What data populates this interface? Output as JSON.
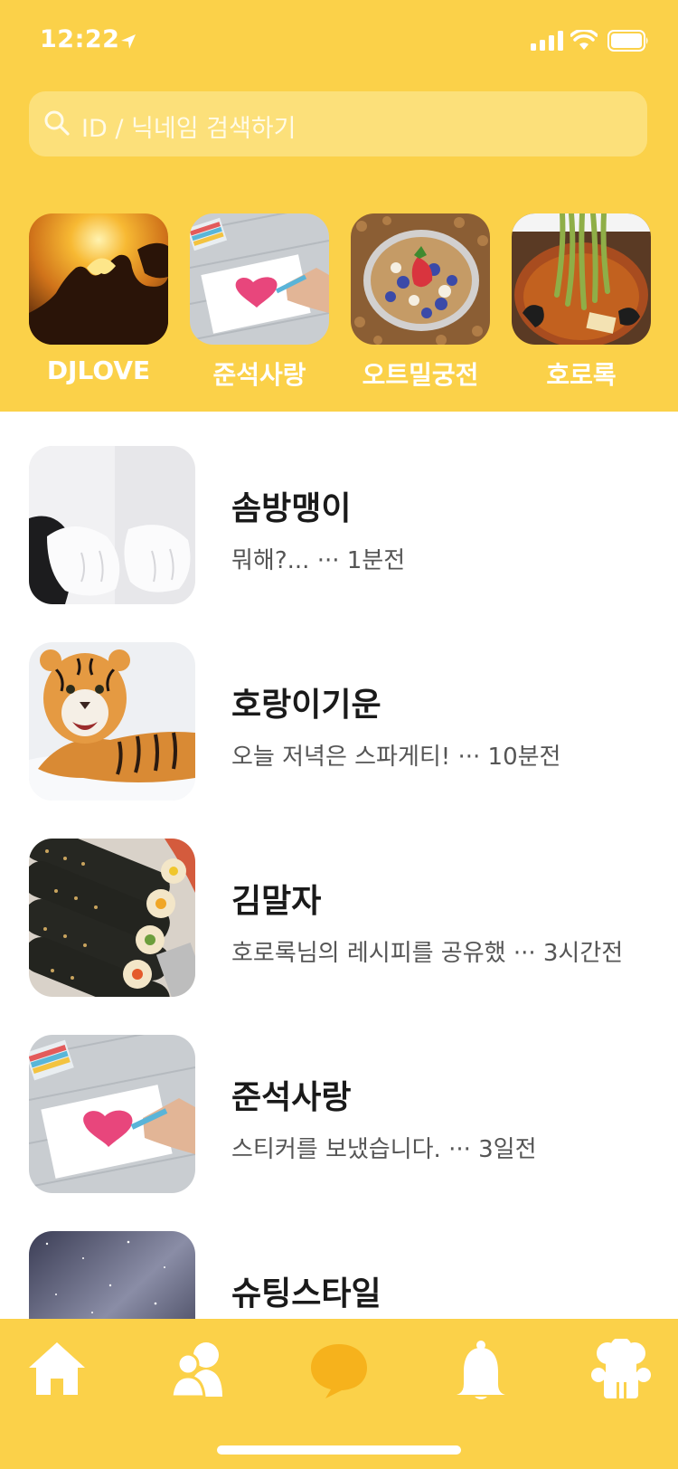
{
  "status_bar": {
    "time": "12:22"
  },
  "search": {
    "placeholder": "ID / 닉네임 검색하기"
  },
  "stories": [
    {
      "name": "DJLOVE",
      "image": "heart-hands-sunset"
    },
    {
      "name": "준석사랑",
      "image": "heart-drawing"
    },
    {
      "name": "오트밀궁전",
      "image": "granola-berries"
    },
    {
      "name": "호로록",
      "image": "green-noodles"
    }
  ],
  "chats": [
    {
      "name": "솜방맹이",
      "message": "뭐해?... ··· 1분전",
      "image": "cat-paws"
    },
    {
      "name": "호랑이기운",
      "message": "오늘 저녁은 스파게티! ··· 10분전",
      "image": "tiger"
    },
    {
      "name": "김말자",
      "message": "호로록님의 레시피를 공유했 ··· 3시간전",
      "image": "kimbap"
    },
    {
      "name": "준석사랑",
      "message": "스티커를 보냈습니다. ··· 3일전",
      "image": "heart-drawing"
    },
    {
      "name": "슈팅스타일",
      "message": "",
      "image": "night-sky"
    }
  ],
  "tabbar": {
    "tabs": [
      {
        "icon": "home-icon",
        "active": false
      },
      {
        "icon": "friends-icon",
        "active": false
      },
      {
        "icon": "chat-icon",
        "active": true
      },
      {
        "icon": "bell-icon",
        "active": false
      },
      {
        "icon": "chef-icon",
        "active": false
      }
    ]
  },
  "colors": {
    "brand_yellow": "#fbd149",
    "active_tab": "#f6b21c",
    "search_bg": "#fce07a"
  }
}
